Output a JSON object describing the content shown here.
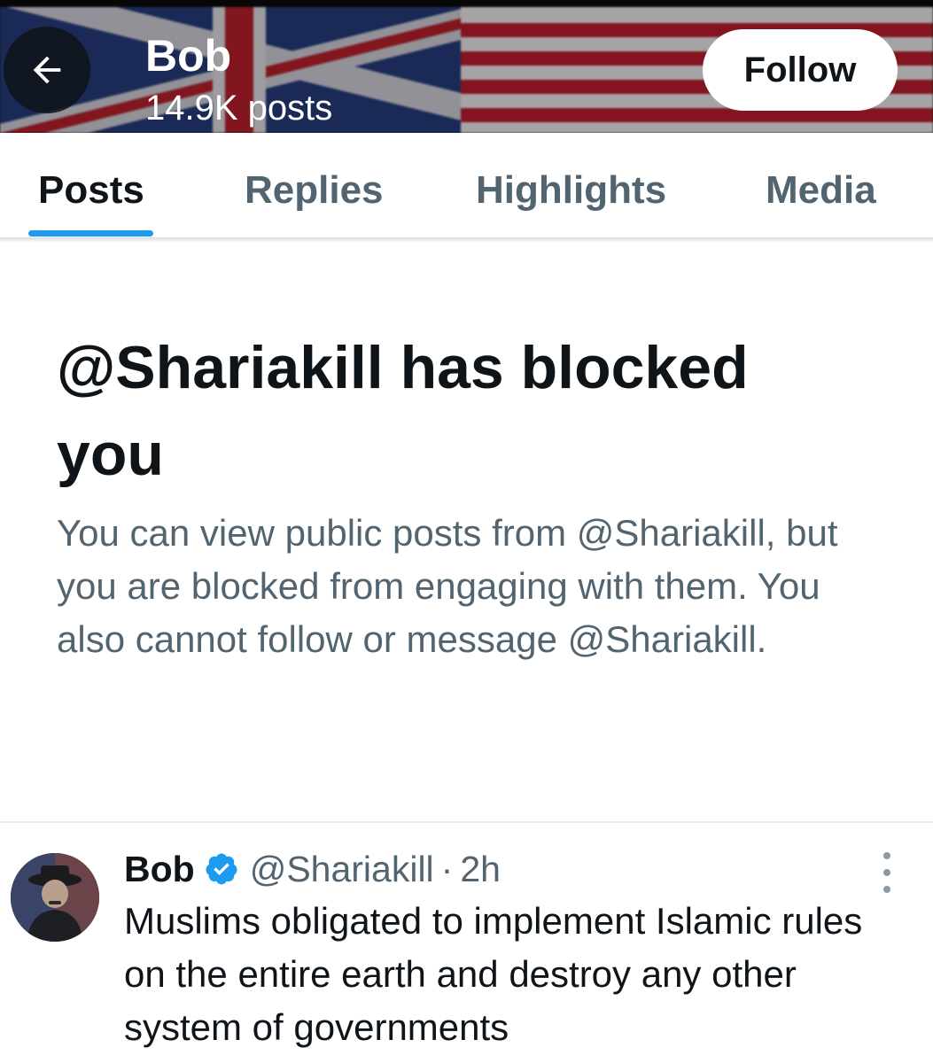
{
  "header": {
    "name": "Bob",
    "posts_count": "14.9K posts",
    "follow_label": "Follow",
    "back_icon": "arrow-left-icon"
  },
  "tabs": [
    {
      "label": "Posts",
      "active": true
    },
    {
      "label": "Replies",
      "active": false
    },
    {
      "label": "Highlights",
      "active": false
    },
    {
      "label": "Media",
      "active": false
    }
  ],
  "blocked": {
    "title": "@Shariakill has blocked you",
    "description": "You can view public posts from @Shariakill, but you are blocked from engaging with them. You also cannot follow or message @Shariakill."
  },
  "post": {
    "author_name": "Bob",
    "handle": "@Shariakill",
    "separator": "·",
    "time": "2h",
    "text": "Muslims obligated to implement Islamic rules on the entire earth and destroy any other system of governments",
    "verified_icon": "verified-badge-icon",
    "more_icon": "more-vertical-icon"
  },
  "colors": {
    "accent": "#1d9bf0",
    "text_primary": "#0f1419",
    "text_secondary": "#536471"
  }
}
